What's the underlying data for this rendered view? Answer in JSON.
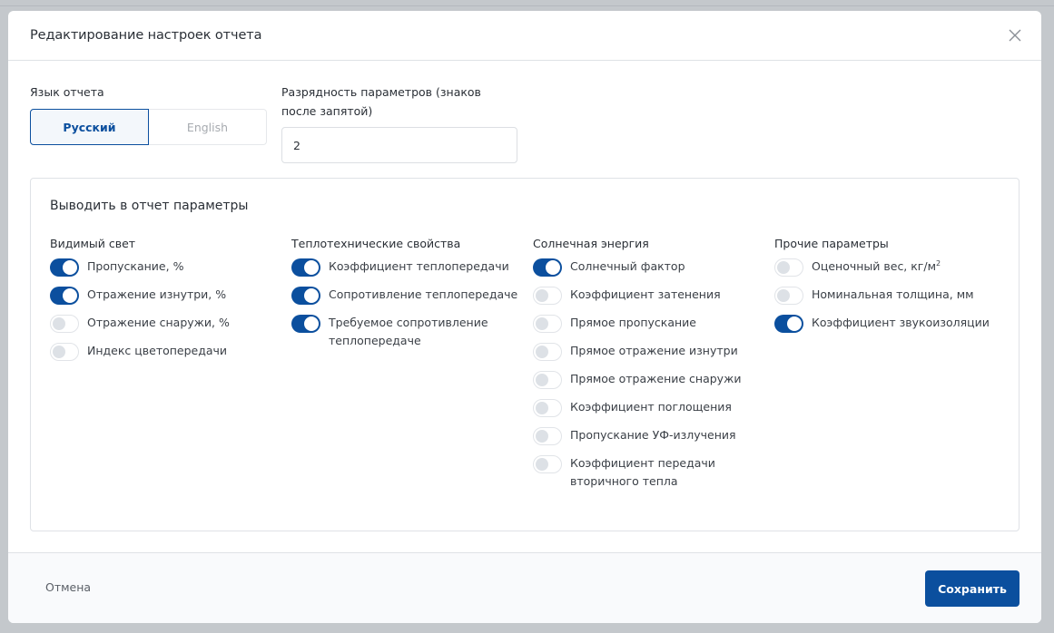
{
  "dialog": {
    "title": "Редактирование настроек отчета",
    "close_icon": "close-icon"
  },
  "language": {
    "label": "Язык отчета",
    "options": [
      "Русский",
      "English"
    ],
    "selected": "Русский"
  },
  "digits": {
    "label_line1": "Разрядность параметров (знаков",
    "label_line2": "после запятой)",
    "value": "2"
  },
  "params": {
    "title": "Выводить в отчет параметры",
    "groups": [
      {
        "title": "Видимый свет",
        "items": [
          {
            "label": "Пропускание, %",
            "on": true
          },
          {
            "label": "Отражение изнутри, %",
            "on": true
          },
          {
            "label": "Отражение снаружи, %",
            "on": false
          },
          {
            "label": "Индекс цветопередачи",
            "on": false
          }
        ]
      },
      {
        "title": "Теплотехнические свойства",
        "items": [
          {
            "label": "Коэффициент теплопередачи",
            "on": true
          },
          {
            "label": "Сопротивление теплопередаче",
            "on": true
          },
          {
            "label": "Требуемое сопротивление теплопередаче",
            "on": true
          }
        ]
      },
      {
        "title": "Солнечная энергия",
        "items": [
          {
            "label": "Солнечный фактор",
            "on": true
          },
          {
            "label": "Коэффициент затенения",
            "on": false
          },
          {
            "label": "Прямое пропускание",
            "on": false
          },
          {
            "label": "Прямое отражение изнутри",
            "on": false
          },
          {
            "label": "Прямое отражение снаружи",
            "on": false
          },
          {
            "label": "Коэффициент поглощения",
            "on": false
          },
          {
            "label": "Пропускание УФ-излучения",
            "on": false
          },
          {
            "label": "Коэффициент передачи вторичного тепла",
            "on": false
          }
        ]
      },
      {
        "title": "Прочие параметры",
        "items": [
          {
            "label": "Оценочный вес, кг/м",
            "sup": "2",
            "on": false
          },
          {
            "label": "Номинальная толщина, мм",
            "on": false
          },
          {
            "label": "Коэффициент звукоизоляции",
            "on": true
          }
        ]
      }
    ]
  },
  "footer": {
    "cancel_label": "Отмена",
    "save_label": "Сохранить"
  },
  "colors": {
    "accent": "#0b4f9e",
    "toggle_off_knob": "#dde1e6",
    "backdrop": "#c4c8cc"
  }
}
